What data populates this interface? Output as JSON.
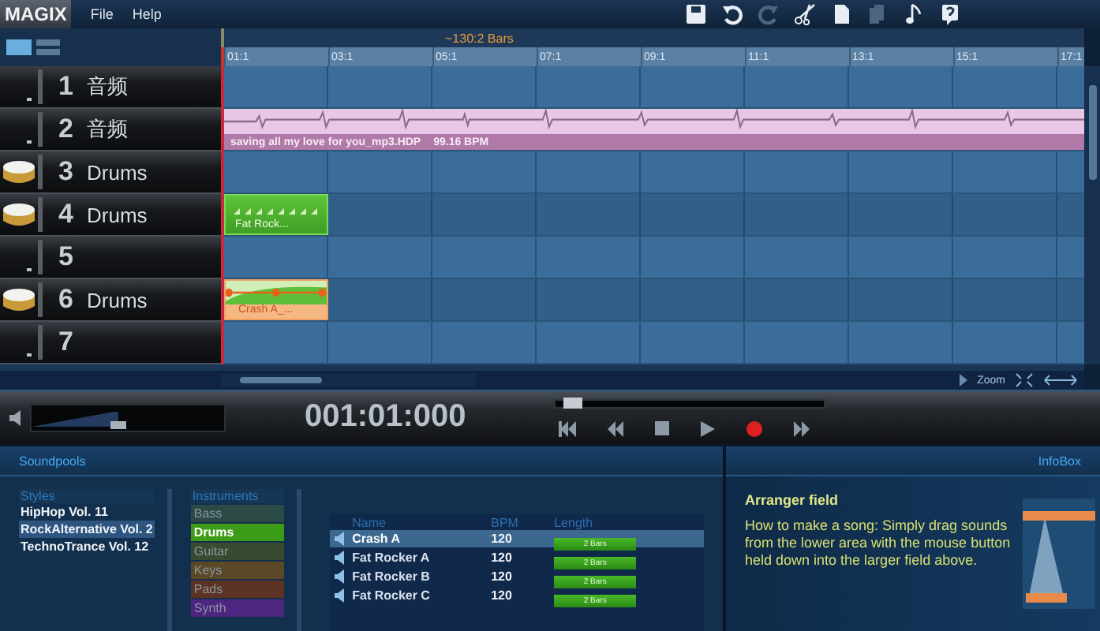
{
  "app": {
    "logo": "MAGIX",
    "menu": [
      "File",
      "Help"
    ]
  },
  "toolbar": [
    {
      "kind": "save",
      "disabled": false
    },
    {
      "kind": "undo",
      "disabled": false
    },
    {
      "kind": "redo",
      "disabled": true
    },
    {
      "kind": "cut",
      "disabled": false
    },
    {
      "kind": "copy",
      "disabled": false
    },
    {
      "kind": "paste",
      "disabled": true
    },
    {
      "kind": "note",
      "disabled": false
    },
    {
      "kind": "help",
      "disabled": false
    }
  ],
  "arranger": {
    "loop_label": "~130:2 Bars",
    "ruler": [
      "01:1",
      "03:1",
      "05:1",
      "07:1",
      "09:1",
      "11:1",
      "13:1",
      "15:1",
      "17:1"
    ],
    "tracks": [
      {
        "number": "1",
        "name": "音频",
        "kind": "audio"
      },
      {
        "number": "2",
        "name": "音频",
        "kind": "audio",
        "clip": {
          "kind": "audio",
          "label": "saving all my love for you_mp3.HDP",
          "bpm": "99.16 BPM"
        }
      },
      {
        "number": "3",
        "name": "Drums",
        "kind": "drums"
      },
      {
        "number": "4",
        "name": "Drums",
        "kind": "drums",
        "clip": {
          "kind": "drum",
          "label": "Fat Rock..."
        }
      },
      {
        "number": "5",
        "kind": "audio"
      },
      {
        "number": "6",
        "name": "Drums",
        "kind": "drums",
        "clip": {
          "kind": "crash",
          "label": "Crash A_..."
        }
      },
      {
        "number": "7",
        "kind": "audio"
      }
    ],
    "zoom_label": "Zoom"
  },
  "transport": {
    "volume": {
      "level": 0.45
    },
    "time": "001:01:000",
    "position": {
      "level": 0.03
    }
  },
  "soundpools": {
    "tab": "Soundpools",
    "styles": {
      "header": "Styles",
      "items": [
        {
          "label": "HipHop Vol. 11",
          "selected": false
        },
        {
          "label": "RockAlternative Vol. 2",
          "selected": true
        },
        {
          "label": "TechnoTrance Vol. 12",
          "selected": false
        }
      ]
    },
    "instruments": {
      "header": "Instruments",
      "items": [
        {
          "label": "Bass",
          "color": "#2c4a46",
          "selected": false
        },
        {
          "label": "Drums",
          "color": "#3c9c18",
          "selected": true
        },
        {
          "label": "Guitar",
          "color": "#394a30",
          "selected": false
        },
        {
          "label": "Keys",
          "color": "#5a4826",
          "selected": false
        },
        {
          "label": "Pads",
          "color": "#5c3222",
          "selected": false
        },
        {
          "label": "Synth",
          "color": "#4c2680",
          "selected": false
        }
      ]
    },
    "table": {
      "columns": [
        "Name",
        "BPM",
        "Length"
      ],
      "rows": [
        {
          "name": "Crash A",
          "bpm": "120",
          "length": "2 Bars",
          "selected": true
        },
        {
          "name": "Fat Rocker A",
          "bpm": "120",
          "length": "2 Bars",
          "selected": false
        },
        {
          "name": "Fat Rocker B",
          "bpm": "120",
          "length": "2 Bars",
          "selected": false
        },
        {
          "name": "Fat Rocker C",
          "bpm": "120",
          "length": "2 Bars",
          "selected": false
        }
      ]
    }
  },
  "infobox": {
    "tab": "InfoBox",
    "title": "Arranger field",
    "text": "How to make a song: Simply drag sounds from the lower area with the mouse button held down into the larger field above."
  }
}
